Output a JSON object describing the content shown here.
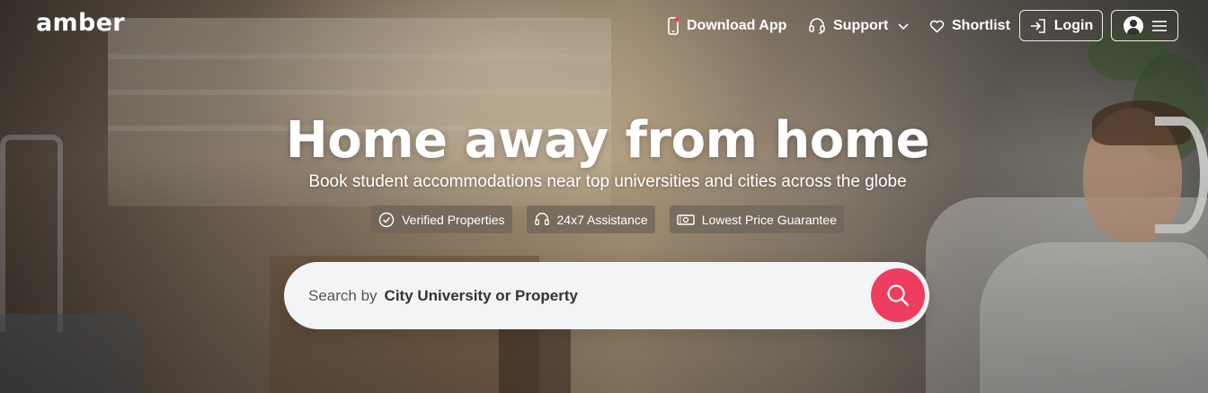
{
  "brand": {
    "logo_text": "amber",
    "accent_color": "#ee3d5e"
  },
  "nav": {
    "download_label": "Download App",
    "support_label": "Support",
    "shortlist_label": "Shortlist",
    "login_label": "Login",
    "icons": [
      "phone-icon",
      "headset-icon",
      "chevron-down-icon",
      "heart-icon",
      "login-icon",
      "avatar-icon",
      "hamburger-icon"
    ]
  },
  "hero": {
    "title": "Home away from home",
    "subtitle": "Book student accommodations near top universities and cities across the globe",
    "badges": [
      {
        "label": "Verified Properties",
        "icon": "check-circle-icon"
      },
      {
        "label": "24x7 Assistance",
        "icon": "headset-icon"
      },
      {
        "label": "Lowest Price Guarantee",
        "icon": "money-icon"
      }
    ]
  },
  "search": {
    "prefix": "Search by",
    "placeholder_strong": "City University or Property",
    "button_icon": "search-icon"
  }
}
